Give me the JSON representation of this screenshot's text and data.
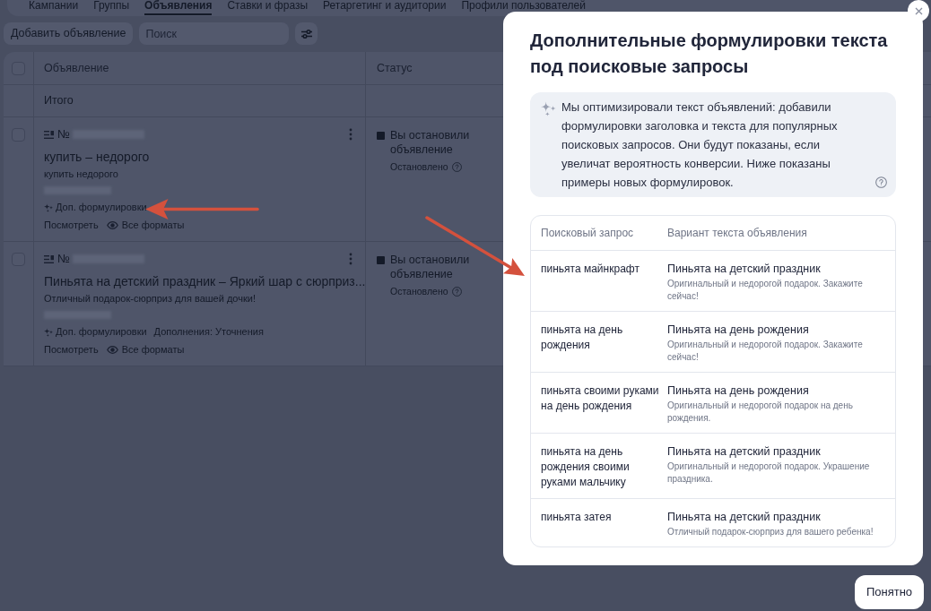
{
  "tabs": [
    {
      "label": "Кампании",
      "selected": false
    },
    {
      "label": "Группы",
      "selected": false
    },
    {
      "label": "Объявления",
      "selected": true
    },
    {
      "label": "Ставки и фразы",
      "selected": false
    },
    {
      "label": "Ретаргетинг и аудитории",
      "selected": false
    },
    {
      "label": "Профили пользователей",
      "selected": false
    }
  ],
  "toolbar": {
    "add_button": "Добавить объявление",
    "search": {
      "placeholder": "Поиск"
    }
  },
  "table": {
    "select_all": {
      "checked": false
    },
    "columns": [
      "Объявление",
      "Статус"
    ],
    "total_label": "Итого",
    "rows": [
      {
        "checked": false,
        "number": "№",
        "title": "купить – недорого",
        "text": "купить недорого",
        "tags": [
          {
            "kind": "sparkle",
            "label": "Доп. формулировки"
          }
        ],
        "links": [
          {
            "kind": "plain",
            "label": "Посмотреть"
          },
          {
            "kind": "eye",
            "label": "Все форматы"
          }
        ],
        "status": {
          "title": "Вы остановили объявление",
          "detail": "Остановлено"
        }
      },
      {
        "checked": false,
        "number": "№",
        "title": "Пиньята на детский праздник – Яркий шар с сюрприз...",
        "text": "Отличный подарок-сюрприз для вашей дочки!",
        "tags": [
          {
            "kind": "sparkle",
            "label": "Доп. формулировки"
          },
          {
            "kind": "plain",
            "label": "Дополнения: Уточнения"
          }
        ],
        "links": [
          {
            "kind": "plain",
            "label": "Посмотреть"
          },
          {
            "kind": "eye",
            "label": "Все форматы"
          }
        ],
        "status": {
          "title": "Вы остановили объявление",
          "detail": "Остановлено"
        }
      }
    ]
  },
  "modal": {
    "title": "Дополнительные формулировки текста под поисковые запросы",
    "info": "Мы оптимизировали текст объявлений: добавили формулировки заголовка и текста для популярных поисковых запросов. Они будут показаны, если увеличат вероятность конверсии. Ниже показаны примеры новых формулировок.",
    "columns": [
      "Поисковый запрос",
      "Вариант текста объявления"
    ],
    "rows": [
      {
        "query": "пиньята майнкрафт",
        "headline": "Пиньята на детский праздник",
        "description": "Оригинальный и недорогой подарок. Закажите сейчас!"
      },
      {
        "query": "пиньята на день рождения",
        "headline": "Пиньята на день рождения",
        "description": "Оригинальный и недорогой подарок. Закажите сейчас!"
      },
      {
        "query": "пиньята своими руками на день рождения",
        "headline": "Пиньята на день рождения",
        "description": "Оригинальный и недорогой подарок на день рождения."
      },
      {
        "query": "пиньята на день рождения своими руками мальчику",
        "headline": "Пиньята на детский праздник",
        "description": "Оригинальный и недорогой подарок. Украшение праздника."
      },
      {
        "query": "пиньята затея",
        "headline": "Пиньята на детский праздник",
        "description": "Отличный подарок-сюрприз для вашего ребенка!"
      }
    ],
    "confirm_button": "Понятно"
  }
}
